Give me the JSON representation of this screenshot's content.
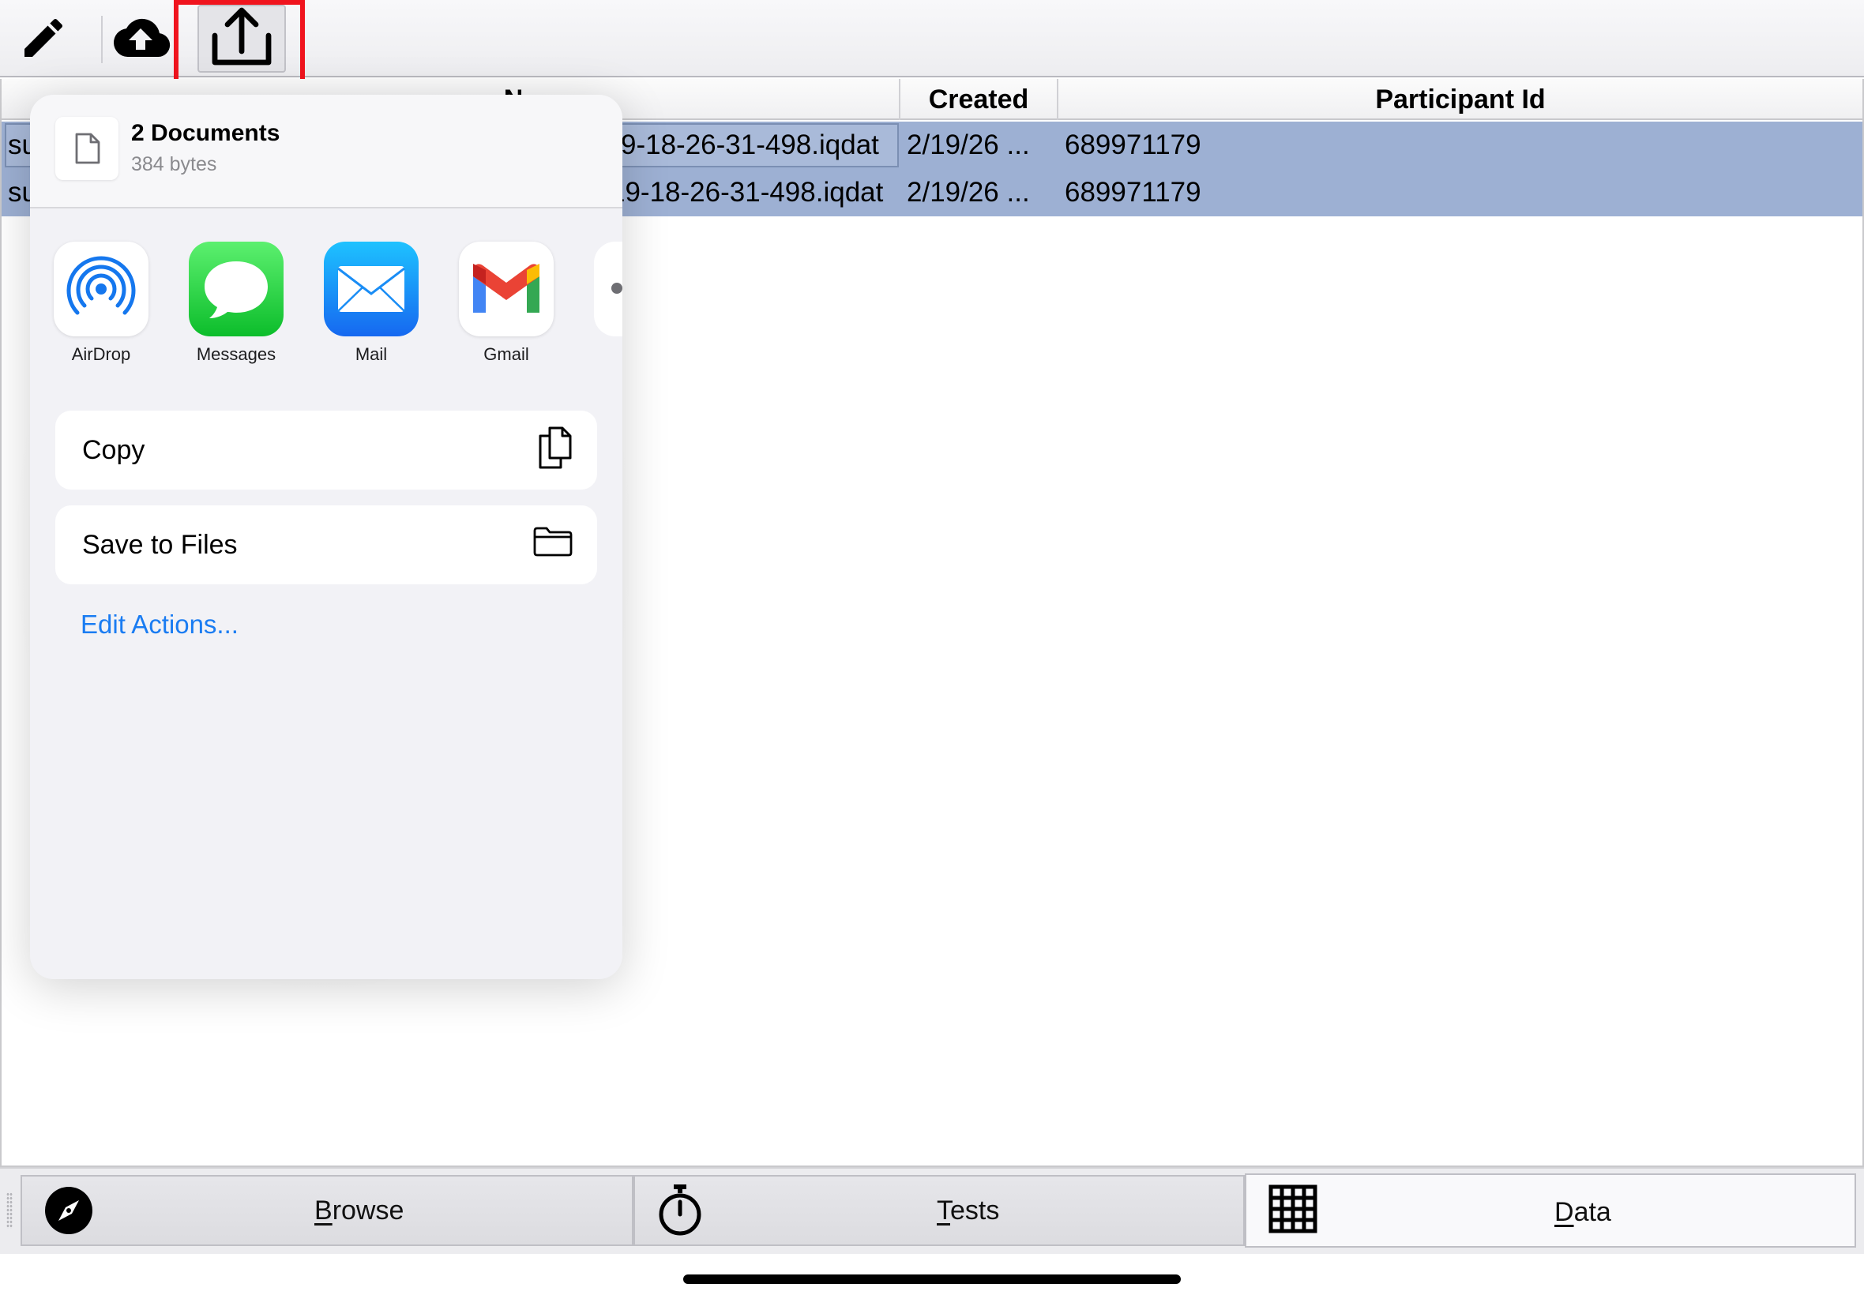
{
  "toolbar": {
    "edit_icon": "pencil-icon",
    "upload_icon": "cloud-upload-icon",
    "share_icon": "share-icon",
    "highlight_color": "#f0141e"
  },
  "table": {
    "columns": [
      {
        "label": "N"
      },
      {
        "label": "Created"
      },
      {
        "label": "Participant Id"
      }
    ],
    "rows": [
      {
        "name_left": "su",
        "name_right": "9-18-26-31-498.iqdat",
        "created": "2/19/26 ...",
        "participant_id": "689971179"
      },
      {
        "name_left": "su",
        "name_right": "19-18-26-31-498.iqdat",
        "created": "2/19/26 ...",
        "participant_id": "689971179"
      }
    ],
    "selected_color": "#9db0d3"
  },
  "share_sheet": {
    "title": "2 Documents",
    "subtitle": "384 bytes",
    "apps": [
      {
        "label": "AirDrop",
        "icon": "airdrop-icon"
      },
      {
        "label": "Messages",
        "icon": "messages-icon"
      },
      {
        "label": "Mail",
        "icon": "mail-icon"
      },
      {
        "label": "Gmail",
        "icon": "gmail-icon"
      }
    ],
    "actions": [
      {
        "label": "Copy",
        "icon": "copy-icon"
      },
      {
        "label": "Save to Files",
        "icon": "folder-icon"
      }
    ],
    "edit_actions": "Edit Actions...",
    "link_color": "#1a7cf2"
  },
  "tabbar": {
    "tabs": [
      {
        "mnemonic": "B",
        "rest": "rowse",
        "icon": "compass-icon",
        "selected": false
      },
      {
        "mnemonic": "T",
        "rest": "ests",
        "icon": "stopwatch-icon",
        "selected": false
      },
      {
        "mnemonic": "D",
        "rest": "ata",
        "icon": "grid-icon",
        "selected": true
      }
    ]
  }
}
